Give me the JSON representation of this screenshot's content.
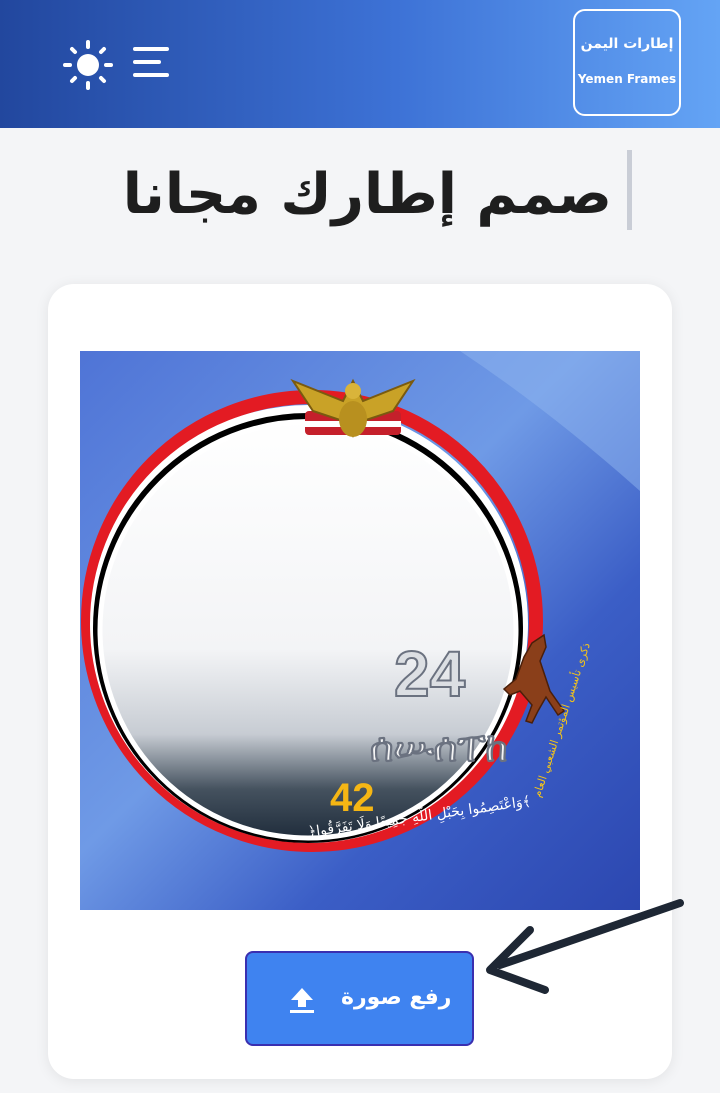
{
  "header": {
    "logo_ar": "إطارات اليمن",
    "logo_en": "Yemen Frames",
    "theme_icon": "sun-icon",
    "menu_icon": "hamburger-menu-icon"
  },
  "page": {
    "title": "صمم إطارك مجانا"
  },
  "frame_preview": {
    "number_top": "24",
    "ancient_script": "ሰሡሰፐከ",
    "number_bottom": "42",
    "verse": "﴿وَاعْتَصِمُوا بِحَبْلِ اللَّهِ جَمِيعًا وَلَا تَفَرَّقُوا﴾",
    "side_text": "ذكرى تأسيس المؤتمر الشعبي العام"
  },
  "upload": {
    "label": "رفع صورة",
    "icon": "upload-icon"
  },
  "colors": {
    "header_start": "#22479e",
    "header_end": "#64a4f5",
    "button": "#3f83f0",
    "flag_red": "#e31b23",
    "flag_black": "#000000"
  }
}
